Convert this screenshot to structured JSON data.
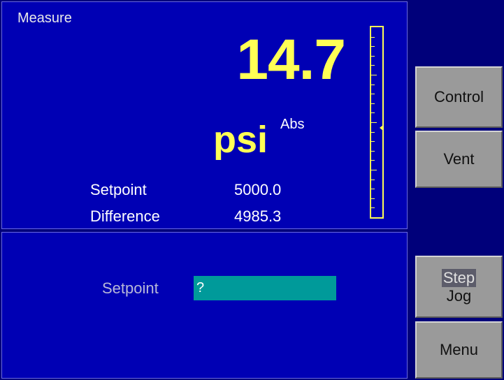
{
  "measure": {
    "mode_label": "Measure",
    "reading": "14.7",
    "unit": "psi",
    "unit_mode": "Abs",
    "setpoint_label": "Setpoint",
    "setpoint_value": "5000.0",
    "difference_label": "Difference",
    "difference_value": "4985.3",
    "bargraph_level": 0.47
  },
  "entry": {
    "label": "Setpoint",
    "value": "?"
  },
  "softkeys": {
    "control": "Control",
    "vent": "Vent",
    "step": "Step",
    "jog": "Jog",
    "menu": "Menu"
  },
  "colors": {
    "panel_bg": "#0000b4",
    "reading": "#ffff55",
    "entry_field": "#009a9a",
    "softkey": "#9a9a9a"
  }
}
